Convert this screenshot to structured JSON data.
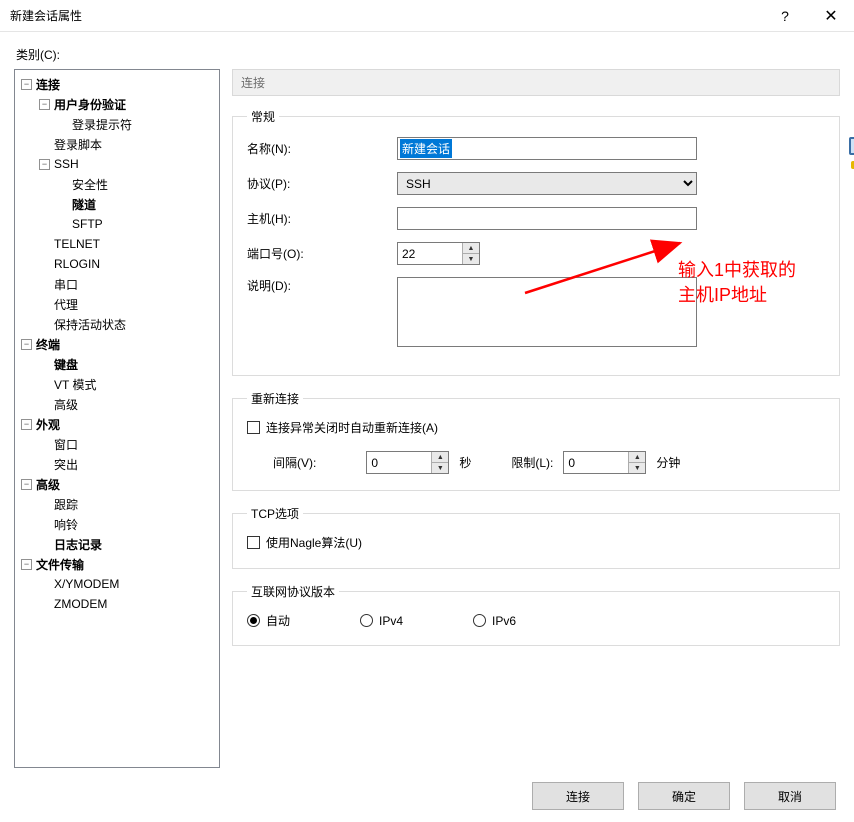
{
  "window": {
    "title": "新建会话属性",
    "help": "?",
    "close": "✕"
  },
  "category_label": "类别(C):",
  "tree": {
    "connection": "连接",
    "auth": "用户身份验证",
    "login_prompt": "登录提示符",
    "login_script": "登录脚本",
    "ssh": "SSH",
    "security": "安全性",
    "tunnel": "隧道",
    "sftp": "SFTP",
    "telnet": "TELNET",
    "rlogin": "RLOGIN",
    "serial": "串口",
    "proxy": "代理",
    "keepalive": "保持活动状态",
    "terminal": "终端",
    "keyboard": "键盘",
    "vtmode": "VT 模式",
    "adv1": "高级",
    "appearance": "外观",
    "window": "窗口",
    "highlight": "突出",
    "advanced": "高级",
    "trace": "跟踪",
    "bell": "响铃",
    "logging": "日志记录",
    "filetransfer": "文件传输",
    "xy": "X/YMODEM",
    "z": "ZMODEM"
  },
  "header": "连接",
  "general": {
    "legend": "常规",
    "name_label": "名称(N):",
    "name_value": "新建会话",
    "protocol_label": "协议(P):",
    "protocol_value": "SSH",
    "host_label": "主机(H):",
    "host_value": "",
    "port_label": "端口号(O):",
    "port_value": "22",
    "desc_label": "说明(D):",
    "desc_value": ""
  },
  "reconnect": {
    "legend": "重新连接",
    "checkbox": "连接异常关闭时自动重新连接(A)",
    "interval_label": "间隔(V):",
    "interval_value": "0",
    "interval_unit": "秒",
    "limit_label": "限制(L):",
    "limit_value": "0",
    "limit_unit": "分钟"
  },
  "tcp": {
    "legend": "TCP选项",
    "nagle": "使用Nagle算法(U)"
  },
  "ipver": {
    "legend": "互联网协议版本",
    "auto": "自动",
    "ipv4": "IPv4",
    "ipv6": "IPv6"
  },
  "buttons": {
    "connect": "连接",
    "ok": "确定",
    "cancel": "取消"
  },
  "annotation": {
    "line1": "输入1中获取的",
    "line2": "主机IP地址"
  }
}
